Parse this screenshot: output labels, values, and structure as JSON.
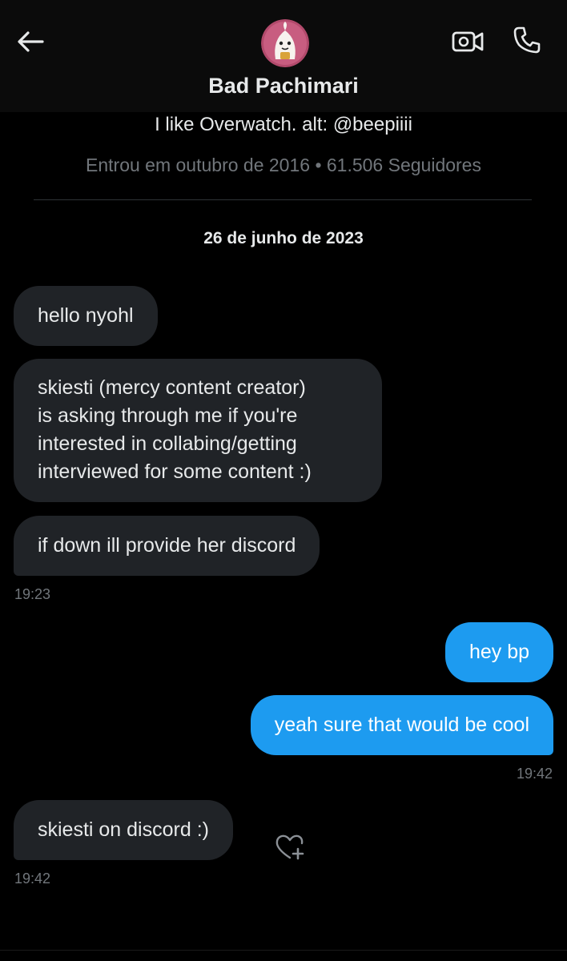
{
  "header": {
    "name": "Bad Pachimari",
    "icons": {
      "back": "back-arrow-icon",
      "video": "video-call-icon",
      "phone": "phone-call-icon",
      "avatar": "pachimari-avatar"
    }
  },
  "profile": {
    "bio": "I like Overwatch. alt: @beepiiii",
    "meta": "Entrou em outubro de 2016 • 61.506 Seguidores"
  },
  "conversation": {
    "date": "26 de junho de 2023",
    "messages": [
      {
        "direction": "incoming",
        "text": "hello nyohl"
      },
      {
        "direction": "incoming",
        "text": "skiesti (mercy content creator)\nis asking through me if you're\ninterested in collabing/getting\ninterviewed for some content :)"
      },
      {
        "direction": "incoming",
        "text": "if down ill provide her discord"
      },
      {
        "direction": "outgoing",
        "text": "hey bp"
      },
      {
        "direction": "outgoing",
        "text": "yeah sure that would be cool"
      },
      {
        "direction": "incoming",
        "text": "skiesti on discord :)"
      }
    ],
    "timestamps": [
      "19:23",
      "19:42",
      "19:42"
    ],
    "reaction_icon": "add-reaction-heart-icon"
  },
  "colors": {
    "background": "#000000",
    "incoming_bubble": "#202327",
    "outgoing_bubble": "#1d9bf0",
    "secondary_text": "#71767b"
  }
}
